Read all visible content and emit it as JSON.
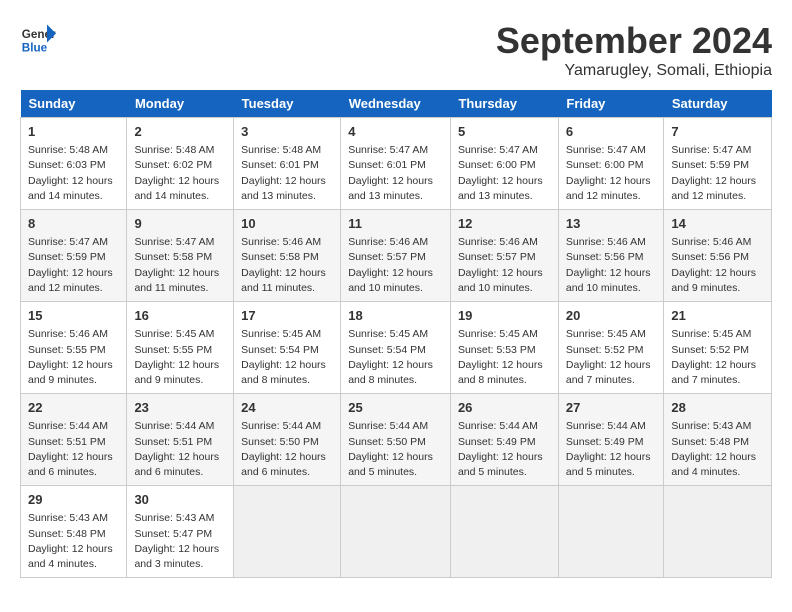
{
  "logo": {
    "line1": "General",
    "line2": "Blue"
  },
  "title": "September 2024",
  "location": "Yamarugley, Somali, Ethiopia",
  "days_of_week": [
    "Sunday",
    "Monday",
    "Tuesday",
    "Wednesday",
    "Thursday",
    "Friday",
    "Saturday"
  ],
  "weeks": [
    [
      {
        "day": "1",
        "sunrise": "5:48 AM",
        "sunset": "6:03 PM",
        "daylight": "12 hours and 14 minutes."
      },
      {
        "day": "2",
        "sunrise": "5:48 AM",
        "sunset": "6:02 PM",
        "daylight": "12 hours and 14 minutes."
      },
      {
        "day": "3",
        "sunrise": "5:48 AM",
        "sunset": "6:01 PM",
        "daylight": "12 hours and 13 minutes."
      },
      {
        "day": "4",
        "sunrise": "5:47 AM",
        "sunset": "6:01 PM",
        "daylight": "12 hours and 13 minutes."
      },
      {
        "day": "5",
        "sunrise": "5:47 AM",
        "sunset": "6:00 PM",
        "daylight": "12 hours and 13 minutes."
      },
      {
        "day": "6",
        "sunrise": "5:47 AM",
        "sunset": "6:00 PM",
        "daylight": "12 hours and 12 minutes."
      },
      {
        "day": "7",
        "sunrise": "5:47 AM",
        "sunset": "5:59 PM",
        "daylight": "12 hours and 12 minutes."
      }
    ],
    [
      {
        "day": "8",
        "sunrise": "5:47 AM",
        "sunset": "5:59 PM",
        "daylight": "12 hours and 12 minutes."
      },
      {
        "day": "9",
        "sunrise": "5:47 AM",
        "sunset": "5:58 PM",
        "daylight": "12 hours and 11 minutes."
      },
      {
        "day": "10",
        "sunrise": "5:46 AM",
        "sunset": "5:58 PM",
        "daylight": "12 hours and 11 minutes."
      },
      {
        "day": "11",
        "sunrise": "5:46 AM",
        "sunset": "5:57 PM",
        "daylight": "12 hours and 10 minutes."
      },
      {
        "day": "12",
        "sunrise": "5:46 AM",
        "sunset": "5:57 PM",
        "daylight": "12 hours and 10 minutes."
      },
      {
        "day": "13",
        "sunrise": "5:46 AM",
        "sunset": "5:56 PM",
        "daylight": "12 hours and 10 minutes."
      },
      {
        "day": "14",
        "sunrise": "5:46 AM",
        "sunset": "5:56 PM",
        "daylight": "12 hours and 9 minutes."
      }
    ],
    [
      {
        "day": "15",
        "sunrise": "5:46 AM",
        "sunset": "5:55 PM",
        "daylight": "12 hours and 9 minutes."
      },
      {
        "day": "16",
        "sunrise": "5:45 AM",
        "sunset": "5:55 PM",
        "daylight": "12 hours and 9 minutes."
      },
      {
        "day": "17",
        "sunrise": "5:45 AM",
        "sunset": "5:54 PM",
        "daylight": "12 hours and 8 minutes."
      },
      {
        "day": "18",
        "sunrise": "5:45 AM",
        "sunset": "5:54 PM",
        "daylight": "12 hours and 8 minutes."
      },
      {
        "day": "19",
        "sunrise": "5:45 AM",
        "sunset": "5:53 PM",
        "daylight": "12 hours and 8 minutes."
      },
      {
        "day": "20",
        "sunrise": "5:45 AM",
        "sunset": "5:52 PM",
        "daylight": "12 hours and 7 minutes."
      },
      {
        "day": "21",
        "sunrise": "5:45 AM",
        "sunset": "5:52 PM",
        "daylight": "12 hours and 7 minutes."
      }
    ],
    [
      {
        "day": "22",
        "sunrise": "5:44 AM",
        "sunset": "5:51 PM",
        "daylight": "12 hours and 6 minutes."
      },
      {
        "day": "23",
        "sunrise": "5:44 AM",
        "sunset": "5:51 PM",
        "daylight": "12 hours and 6 minutes."
      },
      {
        "day": "24",
        "sunrise": "5:44 AM",
        "sunset": "5:50 PM",
        "daylight": "12 hours and 6 minutes."
      },
      {
        "day": "25",
        "sunrise": "5:44 AM",
        "sunset": "5:50 PM",
        "daylight": "12 hours and 5 minutes."
      },
      {
        "day": "26",
        "sunrise": "5:44 AM",
        "sunset": "5:49 PM",
        "daylight": "12 hours and 5 minutes."
      },
      {
        "day": "27",
        "sunrise": "5:44 AM",
        "sunset": "5:49 PM",
        "daylight": "12 hours and 5 minutes."
      },
      {
        "day": "28",
        "sunrise": "5:43 AM",
        "sunset": "5:48 PM",
        "daylight": "12 hours and 4 minutes."
      }
    ],
    [
      {
        "day": "29",
        "sunrise": "5:43 AM",
        "sunset": "5:48 PM",
        "daylight": "12 hours and 4 minutes."
      },
      {
        "day": "30",
        "sunrise": "5:43 AM",
        "sunset": "5:47 PM",
        "daylight": "12 hours and 3 minutes."
      },
      null,
      null,
      null,
      null,
      null
    ]
  ]
}
